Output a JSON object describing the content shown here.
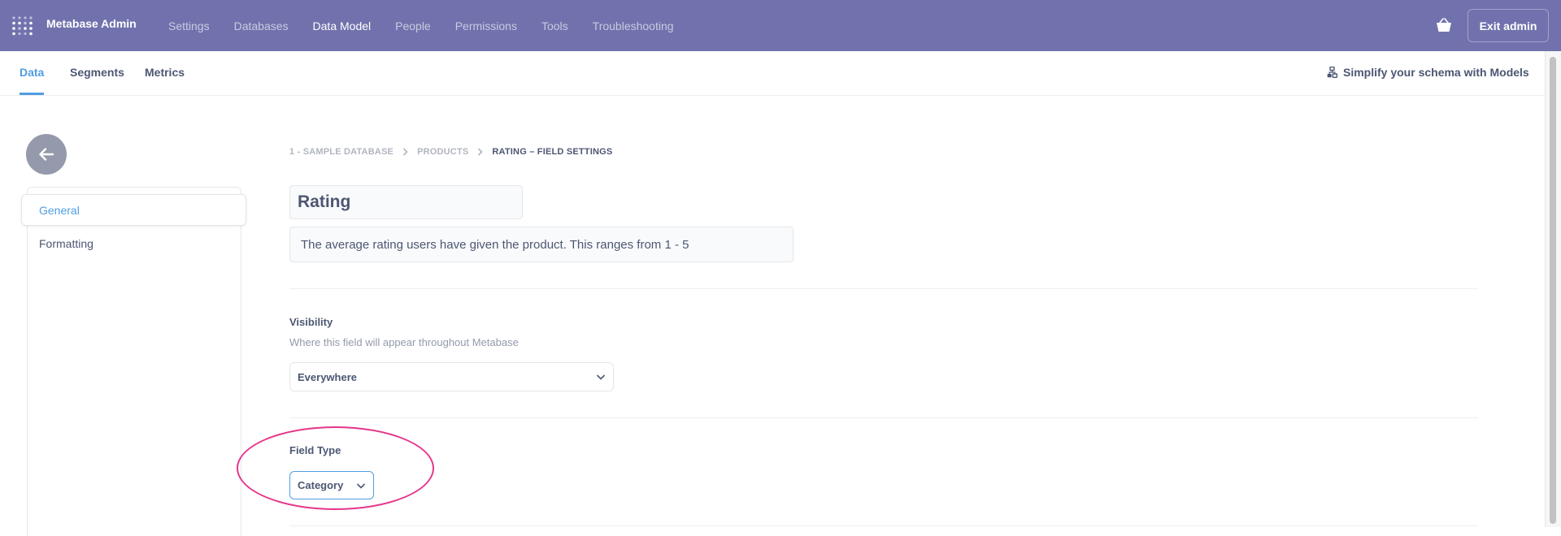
{
  "app": {
    "title": "Metabase Admin"
  },
  "admin_nav": [
    {
      "label": "Settings",
      "active": false
    },
    {
      "label": "Databases",
      "active": false
    },
    {
      "label": "Data Model",
      "active": true
    },
    {
      "label": "People",
      "active": false
    },
    {
      "label": "Permissions",
      "active": false
    },
    {
      "label": "Tools",
      "active": false
    },
    {
      "label": "Troubleshooting",
      "active": false
    }
  ],
  "header": {
    "exit_label": "Exit admin",
    "basket_icon": "basket-icon"
  },
  "tabs": [
    {
      "label": "Data",
      "active": true
    },
    {
      "label": "Segments",
      "active": false
    },
    {
      "label": "Metrics",
      "active": false
    }
  ],
  "models_link": {
    "label": "Simplify your schema with Models",
    "icon": "model-icon"
  },
  "sidebar": {
    "items": [
      {
        "label": "General",
        "active": true
      },
      {
        "label": "Formatting",
        "active": false
      }
    ]
  },
  "breadcrumb": [
    {
      "label": "1 - SAMPLE DATABASE"
    },
    {
      "label": "PRODUCTS"
    },
    {
      "label": "RATING – FIELD SETTINGS"
    }
  ],
  "field": {
    "name": "Rating",
    "description": "The average rating users have given the product. This ranges from 1 - 5"
  },
  "visibility": {
    "title": "Visibility",
    "description": "Where this field will appear throughout Metabase",
    "value": "Everywhere"
  },
  "field_type": {
    "title": "Field Type",
    "value": "Category"
  },
  "colors": {
    "brand": "#509ee3",
    "admin_nav_bg": "#7172ad",
    "annotation": "#e5358b"
  }
}
